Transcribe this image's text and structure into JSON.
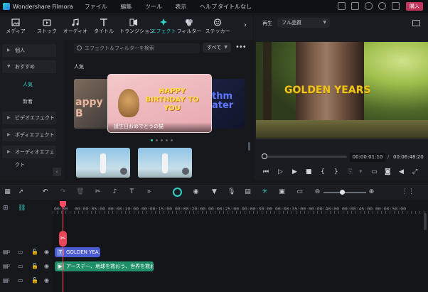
{
  "app": {
    "name": "Wondershare Filmora",
    "menu": [
      "ファイル",
      "編集",
      "ツール",
      "表示",
      "ヘルプ"
    ],
    "doc_title": "タイトルなし",
    "buy_label": "購入"
  },
  "toolbar": {
    "tabs": [
      {
        "label": "メディア",
        "icon": "media-icon"
      },
      {
        "label": "ストック",
        "icon": "stock-icon"
      },
      {
        "label": "オーディオ",
        "icon": "audio-icon"
      },
      {
        "label": "タイトル",
        "icon": "title-icon"
      },
      {
        "label": "トランジション",
        "icon": "transition-icon"
      },
      {
        "label": "エフェクト",
        "icon": "effect-icon",
        "active": true
      },
      {
        "label": "フィルター",
        "icon": "filter-icon"
      },
      {
        "label": "ステッカー",
        "icon": "sticker-icon"
      }
    ],
    "accent_color": "#2fd3c2"
  },
  "sidebar": {
    "items": [
      {
        "label": "個人"
      },
      {
        "label": "おすすめ",
        "expanded": true,
        "children": [
          {
            "label": "人気",
            "active": true
          },
          {
            "label": "新着"
          }
        ]
      },
      {
        "label": "ビデオエフェクト"
      },
      {
        "label": "ボディエフェクト"
      },
      {
        "label": "オーディオエフェクト"
      }
    ]
  },
  "browser": {
    "search_placeholder": "エフェクト＆フィルターを検索",
    "filter_label": "すべて",
    "section_title": "人気",
    "featured_caption": "誕生日おめでとうの猫",
    "featured_text": "HAPPY BIRTHDAY TO YOU",
    "left_thumb_text": "appy B",
    "right_thumb_text": "thm ater"
  },
  "player": {
    "label": "再生",
    "quality": "フル品質",
    "overlay_text": "GOLDEN YEARS",
    "current_time": "00:00:01:10",
    "total_time": "00:06:48:20",
    "progress": 0.02
  },
  "timeline": {
    "ruler_labels": [
      "00:00",
      "00:00:05:00",
      "00:00:10:00",
      "00:00:15:00",
      "00:00:20:00",
      "00:00:25:00",
      "00:00:30:00",
      "00:00:35:00",
      "00:00:40:00",
      "00:00:45:00",
      "00:00:50:00"
    ],
    "tracks": [
      {
        "number": "3",
        "clip_label": "GOLDEN YEA...",
        "clip_type": "title",
        "color": "#4b5bd1"
      },
      {
        "number": "2",
        "clip_label": "アースデー、地球を救おう、世界を救おう...",
        "clip_type": "video",
        "color": "#1f8f6a"
      },
      {
        "number": "1"
      }
    ],
    "zoom_level": 0.45
  }
}
